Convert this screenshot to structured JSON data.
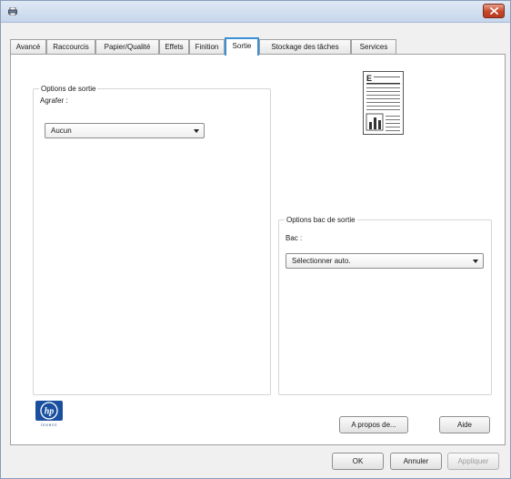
{
  "window": {
    "accent_color": "#3a8fd6",
    "close_color": "#c4462b"
  },
  "tabs": [
    {
      "label": "Avancé",
      "active": false
    },
    {
      "label": "Raccourcis",
      "active": false
    },
    {
      "label": "Papier/Qualité",
      "active": false
    },
    {
      "label": "Effets",
      "active": false
    },
    {
      "label": "Finition",
      "active": false
    },
    {
      "label": "Sortie",
      "active": true
    },
    {
      "label": "Stockage des tâches",
      "active": false
    },
    {
      "label": "Services",
      "active": false
    }
  ],
  "output_options": {
    "legend": "Options de sortie",
    "staple_label": "Agrafer :",
    "staple_value": "Aucun"
  },
  "output_bin": {
    "legend": "Options bac de sortie",
    "bin_label": "Bac :",
    "bin_value": "Sélectionner auto."
  },
  "preview": {
    "page_letter": "E"
  },
  "logo": {
    "text": "hp",
    "tagline": "invent"
  },
  "buttons": {
    "about": "A propos de...",
    "help": "Aide",
    "ok": "OK",
    "cancel": "Annuler",
    "apply": "Appliquer"
  }
}
